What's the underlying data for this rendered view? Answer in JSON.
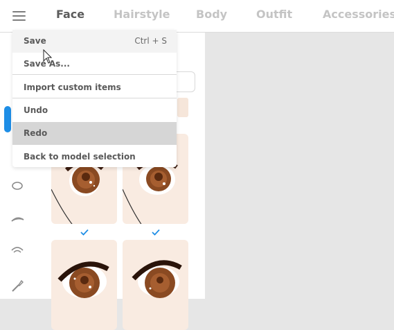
{
  "tabs": [
    {
      "label": "Face",
      "active": true
    },
    {
      "label": "Hairstyle",
      "active": false
    },
    {
      "label": "Body",
      "active": false
    },
    {
      "label": "Outfit",
      "active": false
    },
    {
      "label": "Accessories",
      "active": false
    }
  ],
  "menu": {
    "items": [
      {
        "label": "Save",
        "shortcut": "Ctrl + S",
        "state": "hover"
      },
      {
        "label": "Save As...",
        "shortcut": "",
        "state": "normal"
      },
      {
        "label": "Import custom items",
        "shortcut": "",
        "state": "normal"
      },
      {
        "label": "Undo",
        "shortcut": "",
        "state": "normal"
      },
      {
        "label": "Redo",
        "shortcut": "",
        "state": "highlighted"
      },
      {
        "label": "Back to model selection",
        "shortcut": "",
        "state": "normal"
      }
    ]
  },
  "sidebar_icons": [
    "eye-outline-icon",
    "eyebrow-icon",
    "ear-icon",
    "brush-icon"
  ],
  "thumbnails": [
    {
      "name": "eye-thumb-1",
      "selected": true
    },
    {
      "name": "eye-thumb-2",
      "selected": true
    },
    {
      "name": "eye-thumb-3",
      "selected": false
    },
    {
      "name": "eye-thumb-4",
      "selected": false
    }
  ],
  "colors": {
    "accent": "#1e8ee6",
    "active_tab": "#5c5c5c",
    "inactive_tab": "#c4c4c4",
    "menu_highlight": "#d6d6d6",
    "skin": "#f9ebe1",
    "iris": "#8a4a22"
  }
}
